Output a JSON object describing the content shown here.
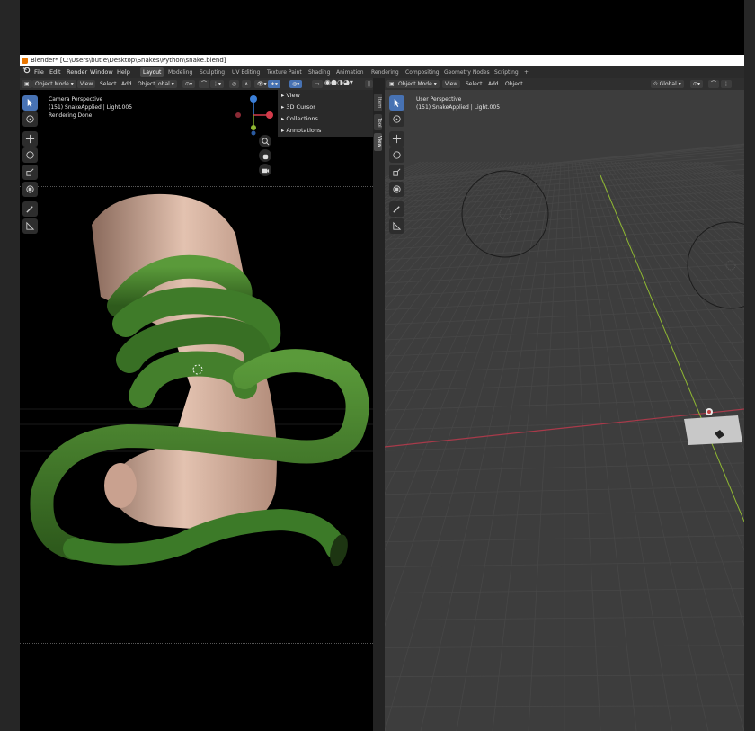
{
  "window": {
    "title": "Blender* [C:\\Users\\butle\\Desktop\\Snakes\\Python\\snake.blend]"
  },
  "menu": [
    "File",
    "Edit",
    "Render",
    "Window",
    "Help"
  ],
  "workspaces": [
    "Layout",
    "Modeling",
    "Sculpting",
    "UV Editing",
    "Texture Paint",
    "Shading",
    "Animation",
    "Rendering",
    "Compositing",
    "Geometry Nodes",
    "Scripting",
    "+"
  ],
  "left_header": {
    "mode": "Object Mode",
    "view": "View",
    "select": "Select",
    "add": "Add",
    "object": "Object",
    "transform": "obal"
  },
  "right_header": {
    "mode": "Object Mode",
    "view": "View",
    "select": "Select",
    "add": "Add",
    "object": "Object",
    "transform": "Global"
  },
  "left_viewport": {
    "line1": "Camera Perspective",
    "line2": "(151) SnakeApplied | Light.005",
    "line3": "Rendering Done"
  },
  "right_viewport": {
    "line1": "User Perspective",
    "line2": "(151) SnakeApplied | Light.005"
  },
  "sidebar_panel": {
    "rows": [
      "View",
      "3D Cursor",
      "Collections",
      "Annotations"
    ],
    "tabs": [
      "Item",
      "Tool",
      "View"
    ]
  },
  "colors": {
    "accent": "#4772b3",
    "snake_green": "#3e7a2a",
    "axis_red": "#a83a4a",
    "axis_green": "#8fb832",
    "skin": "#d4a992"
  }
}
